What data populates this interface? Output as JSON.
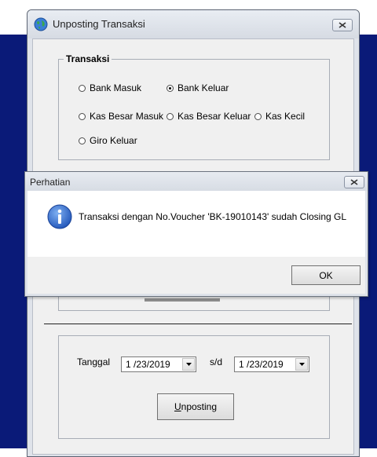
{
  "main_window": {
    "title": "Unposting Transaksi",
    "group_label": "Transaksi",
    "radios": [
      {
        "label": "Bank Masuk",
        "checked": false
      },
      {
        "label": "Bank Keluar",
        "checked": true
      },
      {
        "label": "Kas Besar Masuk",
        "checked": false
      },
      {
        "label": "Kas Besar Keluar",
        "checked": false
      },
      {
        "label": "Kas Kecil",
        "checked": false
      },
      {
        "label": "Giro Keluar",
        "checked": false
      }
    ],
    "date_label": "Tanggal",
    "range_separator": "s/d",
    "date_from": "1 /23/2019",
    "date_to": "1 /23/2019",
    "unposting_button": "Unposting"
  },
  "dialog": {
    "title": "Perhatian",
    "message": "Transaksi dengan No.Voucher 'BK-19010143' sudah Closing GL",
    "ok_button": "OK"
  },
  "colors": {
    "background_navy": "#0a1a78",
    "window_frame": "#dfe3ea",
    "client_area": "#f0f0f0",
    "info_blue": "#2a63c9"
  }
}
